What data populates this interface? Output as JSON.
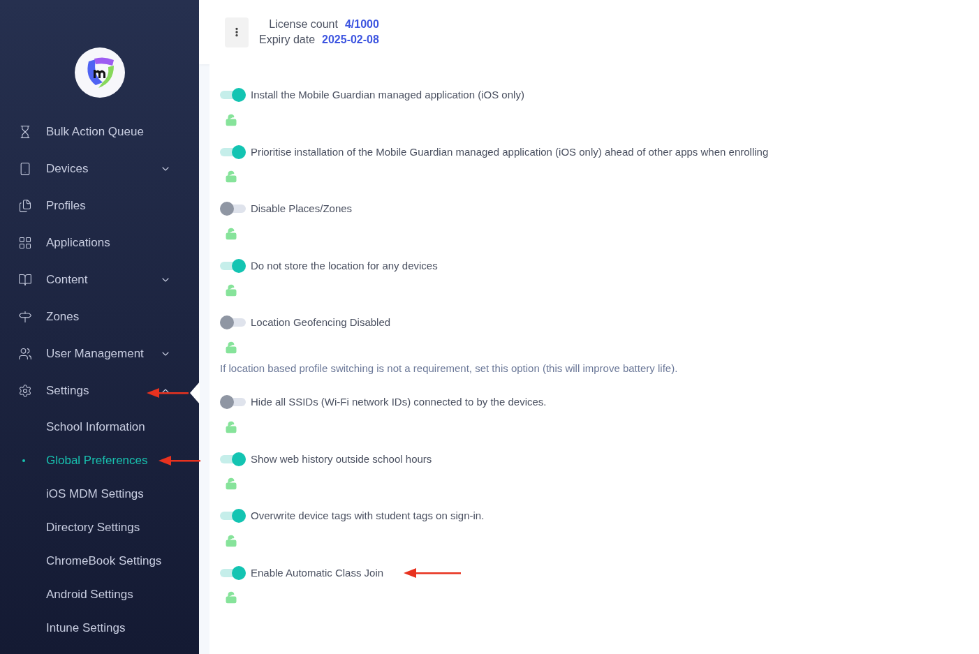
{
  "header": {
    "license_label": "License count",
    "license_value": "4/1000",
    "expiry_label": "Expiry date",
    "expiry_value": "2025-02-08"
  },
  "sidebar": {
    "items": [
      {
        "label": "Bulk Action Queue"
      },
      {
        "label": "Devices",
        "expanded": false
      },
      {
        "label": "Profiles"
      },
      {
        "label": "Applications"
      },
      {
        "label": "Content",
        "expanded": false
      },
      {
        "label": "Zones"
      },
      {
        "label": "User Management",
        "expanded": false
      },
      {
        "label": "Settings",
        "expanded": true,
        "children": [
          {
            "label": "School Information",
            "selected": false
          },
          {
            "label": "Global Preferences",
            "selected": true
          },
          {
            "label": "iOS MDM Settings",
            "selected": false
          },
          {
            "label": "Directory Settings",
            "selected": false
          },
          {
            "label": "ChromeBook Settings",
            "selected": false
          },
          {
            "label": "Android Settings",
            "selected": false
          },
          {
            "label": "Intune Settings",
            "selected": false
          }
        ]
      }
    ]
  },
  "settings": [
    {
      "label": "Install the Mobile Guardian managed application (iOS only)",
      "on": true,
      "locked": false
    },
    {
      "label": "Prioritise installation of the Mobile Guardian managed application (iOS only) ahead of other apps when enrolling",
      "on": true,
      "locked": false
    },
    {
      "label": "Disable Places/Zones",
      "on": false,
      "locked": false
    },
    {
      "label": "Do not store the location for any devices",
      "on": true,
      "locked": false
    },
    {
      "label": "Location Geofencing Disabled",
      "on": false,
      "locked": false,
      "help": "If location based profile switching is not a requirement, set this option (this will improve battery life)."
    },
    {
      "label": "Hide all SSIDs (Wi-Fi network IDs) connected to by the devices.",
      "on": false,
      "locked": false
    },
    {
      "label": "Show web history outside school hours",
      "on": true,
      "locked": false
    },
    {
      "label": "Overwrite device tags with student tags on sign-in.",
      "on": true,
      "locked": false
    },
    {
      "label": "Enable Automatic Class Join",
      "on": true,
      "locked": false
    }
  ]
}
